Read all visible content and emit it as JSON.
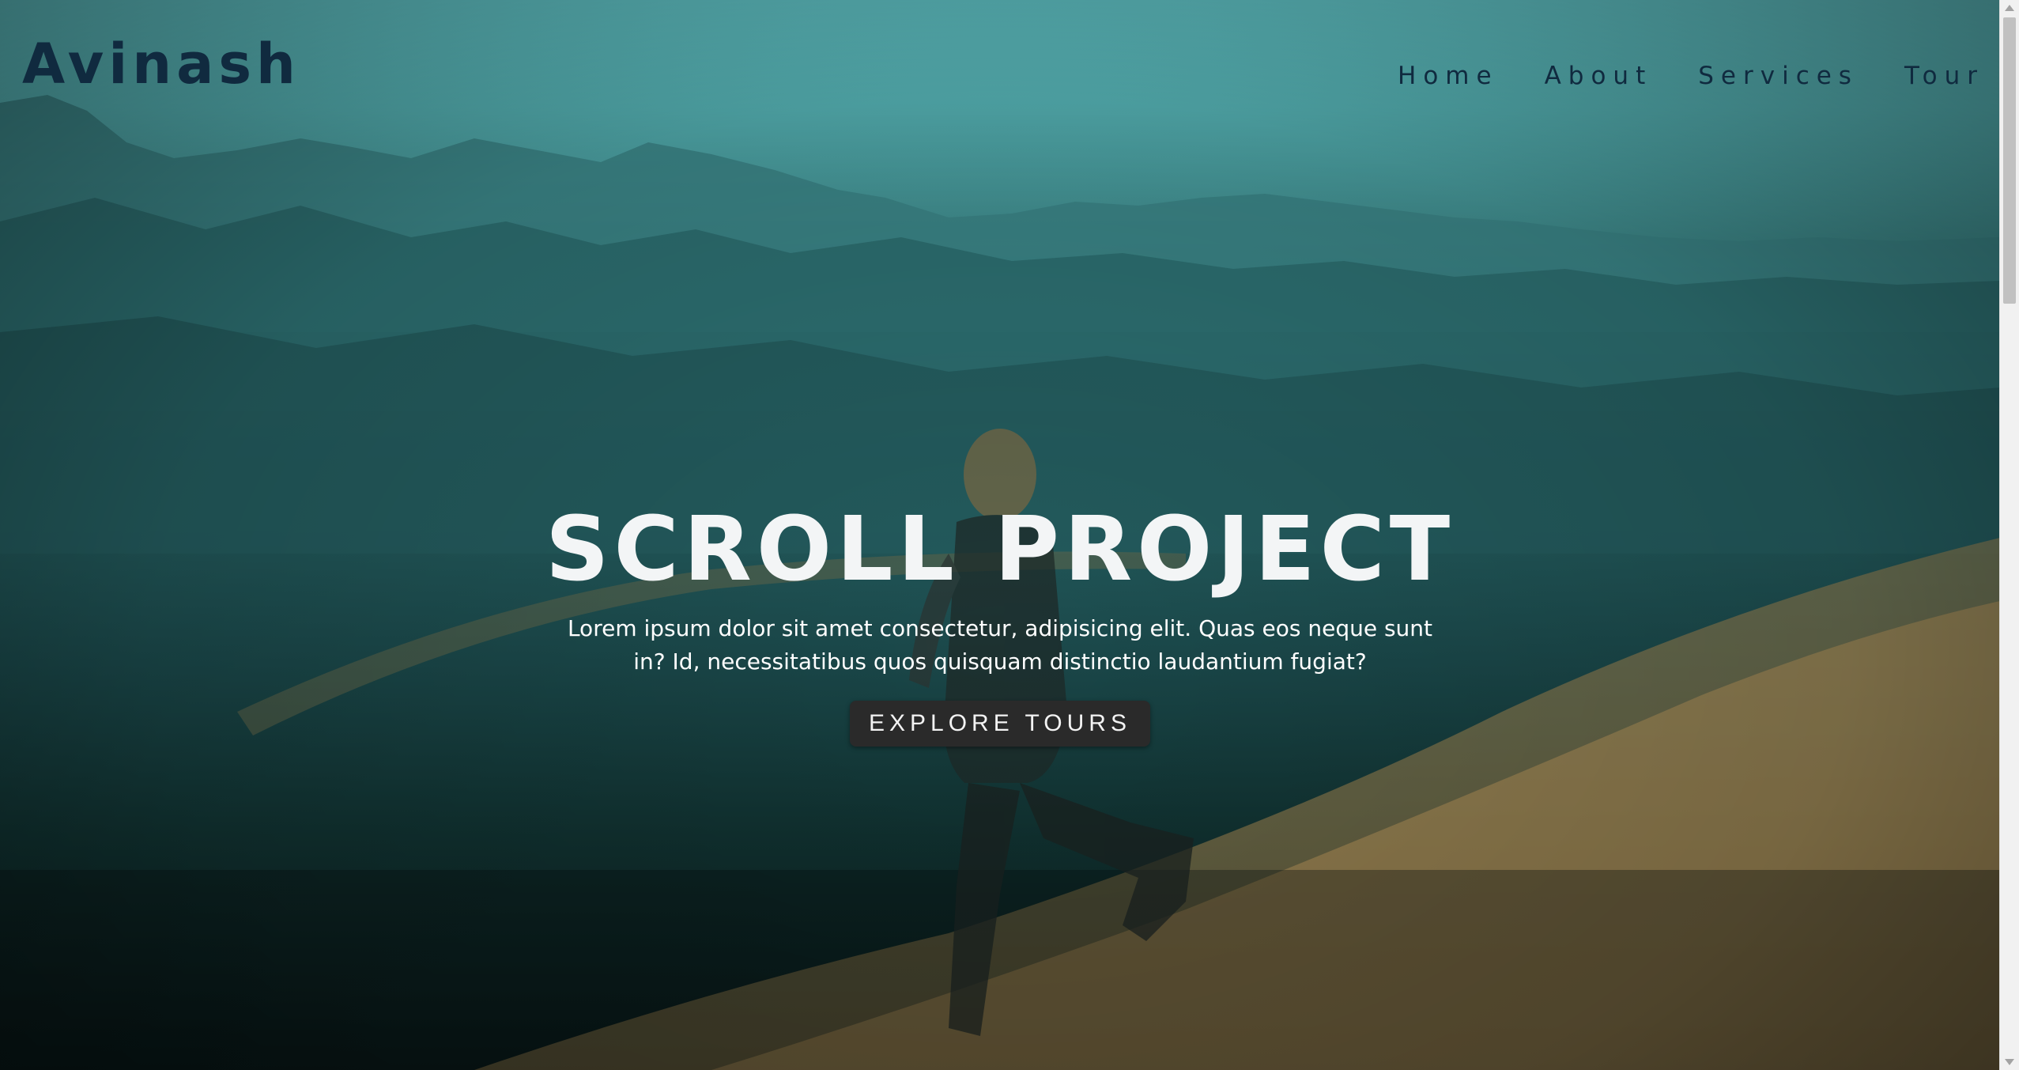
{
  "brand": {
    "name": "Avinash"
  },
  "nav": {
    "links": [
      {
        "label": "Home"
      },
      {
        "label": "About"
      },
      {
        "label": "Services"
      },
      {
        "label": "Tour"
      }
    ]
  },
  "banner": {
    "title": "SCROLL PROJECT",
    "text": "Lorem ipsum dolor sit amet consectetur, adipisicing elit. Quas eos neque sunt in? Id, necessitatibus quos quisquam distinctio laudantium fugiat?",
    "button_label": "EXPLORE TOURS"
  },
  "colors": {
    "brand_text": "#102a3f",
    "banner_text": "#f3f5f6",
    "button_bg": "#2a2a2a",
    "sky": "#63c9cc"
  },
  "background": {
    "icon": "desert-hiker-photo"
  }
}
